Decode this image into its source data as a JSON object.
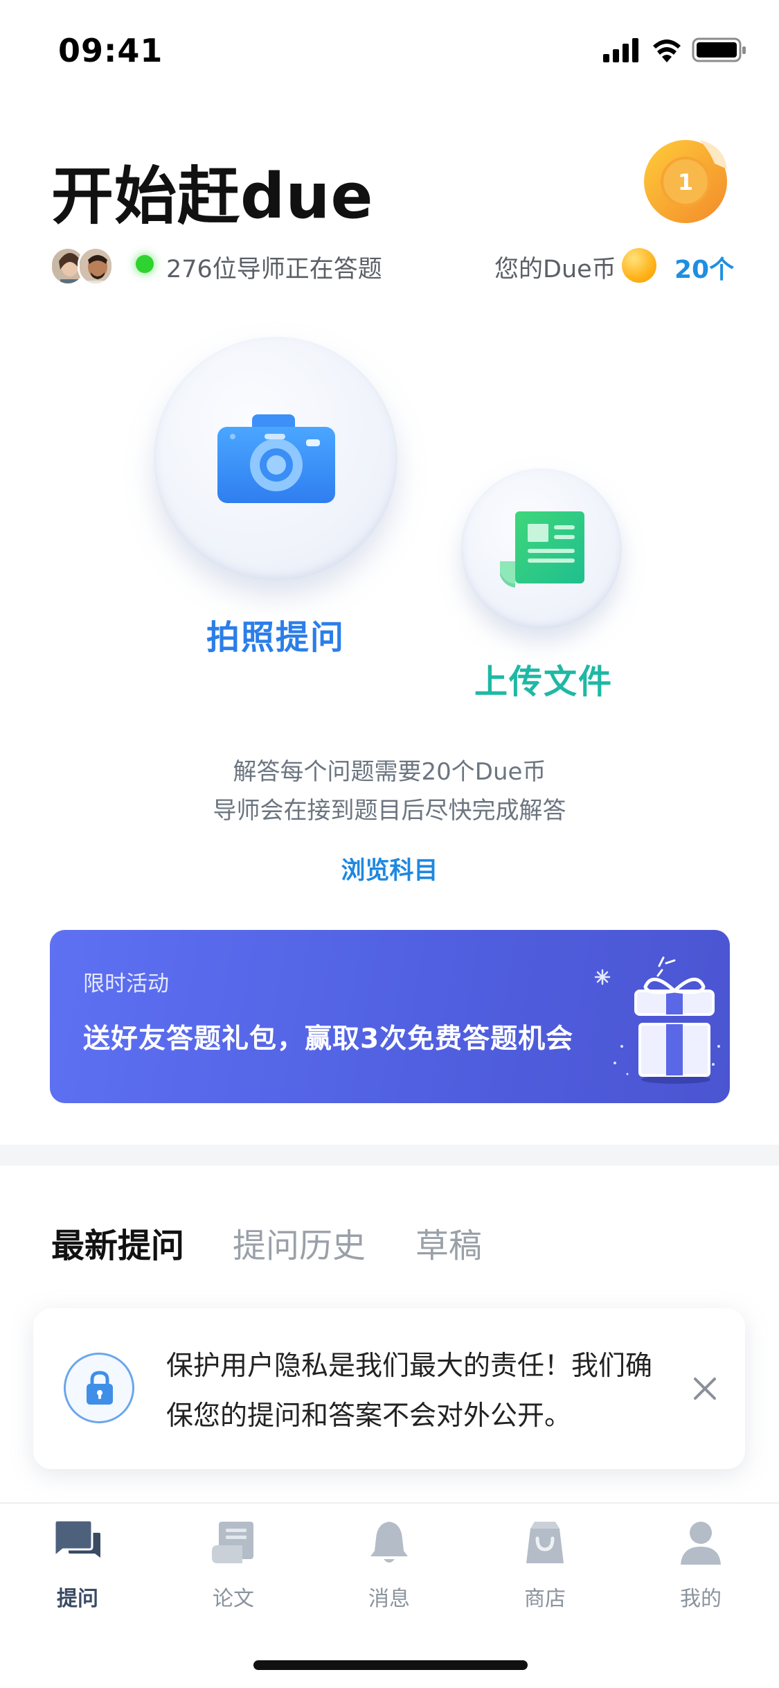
{
  "status_bar": {
    "time": "09:41"
  },
  "header": {
    "title": "开始赶due",
    "medal_number": "1",
    "online_text": "276位导师正在答题",
    "coin_label": "您的Due币",
    "coin_count": "20个"
  },
  "actions": {
    "photo_label": "拍照提问",
    "upload_label": "上传文件"
  },
  "info": {
    "line1": "解答每个问题需要20个Due币",
    "line2": "导师会在接到题目后尽快完成解答",
    "browse_link": "浏览科目"
  },
  "promo": {
    "tag": "限时活动",
    "text": "送好友答题礼包，赢取3次免费答题机会"
  },
  "tabs": [
    {
      "label": "最新提问",
      "active": true
    },
    {
      "label": "提问历史",
      "active": false
    },
    {
      "label": "草稿",
      "active": false
    }
  ],
  "privacy": {
    "line1": "保护用户隐私是我们最大的责任！我们确",
    "line2": "保您的提问和答案不会对外公开。"
  },
  "bottom_nav": [
    {
      "label": "提问",
      "icon": "chat-bubbles-icon",
      "active": true
    },
    {
      "label": "论文",
      "icon": "scroll-icon",
      "active": false
    },
    {
      "label": "消息",
      "icon": "bell-icon",
      "active": false
    },
    {
      "label": "商店",
      "icon": "shopping-bag-icon",
      "active": false
    },
    {
      "label": "我的",
      "icon": "user-icon",
      "active": false
    }
  ],
  "colors": {
    "accent_blue": "#1e88e0",
    "accent_teal": "#1fb8a4",
    "promo_bg": "#5060e0",
    "online_green": "#2fd32f"
  }
}
